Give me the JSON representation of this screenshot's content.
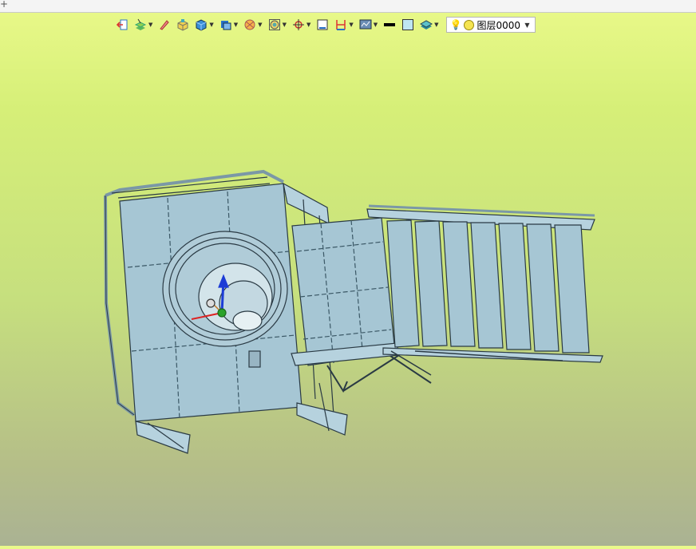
{
  "topstrip": {
    "symbol": "+"
  },
  "toolbar": {
    "tools": [
      {
        "icon": "exit-icon",
        "dropdown": false
      },
      {
        "icon": "layers-tool-icon",
        "dropdown": true
      },
      {
        "icon": "pen-icon",
        "dropdown": false
      },
      {
        "icon": "box-highlight-icon",
        "dropdown": false
      },
      {
        "icon": "solid-cube-icon",
        "dropdown": true
      },
      {
        "icon": "shaded-view-icon",
        "dropdown": true
      },
      {
        "icon": "section-icon",
        "dropdown": true
      },
      {
        "icon": "render-mode-icon",
        "dropdown": true
      },
      {
        "icon": "crosshair-icon",
        "dropdown": true
      },
      {
        "icon": "frame-icon",
        "dropdown": false
      },
      {
        "icon": "dimension-icon",
        "dropdown": true
      },
      {
        "icon": "display-settings-icon",
        "dropdown": true
      },
      {
        "icon": "line-color-icon",
        "dropdown": false
      },
      {
        "icon": "fill-color-icon",
        "dropdown": false
      },
      {
        "icon": "layer-stack-icon",
        "dropdown": true
      }
    ],
    "layer_select": {
      "value": "图层0000"
    }
  },
  "colors": {
    "accent_blue": "#2a72c8",
    "model_fill": "#a6c6d4",
    "model_stroke": "#2a3a44"
  }
}
